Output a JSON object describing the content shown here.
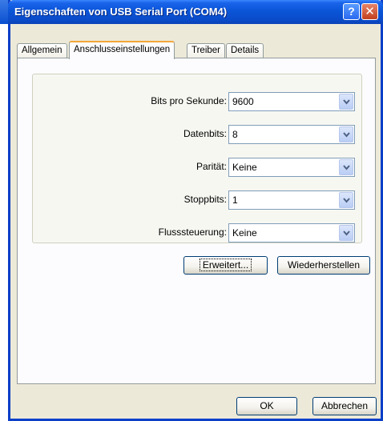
{
  "dialog": {
    "title": "Eigenschaften von USB Serial Port (COM4)",
    "help_label": "?",
    "close_label": "✕"
  },
  "tabs": [
    {
      "label": "Allgemein"
    },
    {
      "label": "Anschlusseinstellungen"
    },
    {
      "label": "Treiber"
    },
    {
      "label": "Details"
    }
  ],
  "settings": {
    "bits_label": "Bits pro Sekunde:",
    "bits_value": "9600",
    "data_label": "Datenbits:",
    "data_value": "8",
    "parity_label": "Parität:",
    "parity_value": "Keine",
    "stop_label": "Stoppbits:",
    "stop_value": "1",
    "flow_label": "Flusssteuerung:",
    "flow_value": "Keine"
  },
  "buttons": {
    "advanced": "Erweitert...",
    "restore": "Wiederherstellen",
    "ok": "OK",
    "cancel": "Abbrechen"
  },
  "colors": {
    "titlebar": "#0a55d8",
    "dialog_bg": "#ece9d8",
    "active_tab_accent": "#f3a63a"
  }
}
